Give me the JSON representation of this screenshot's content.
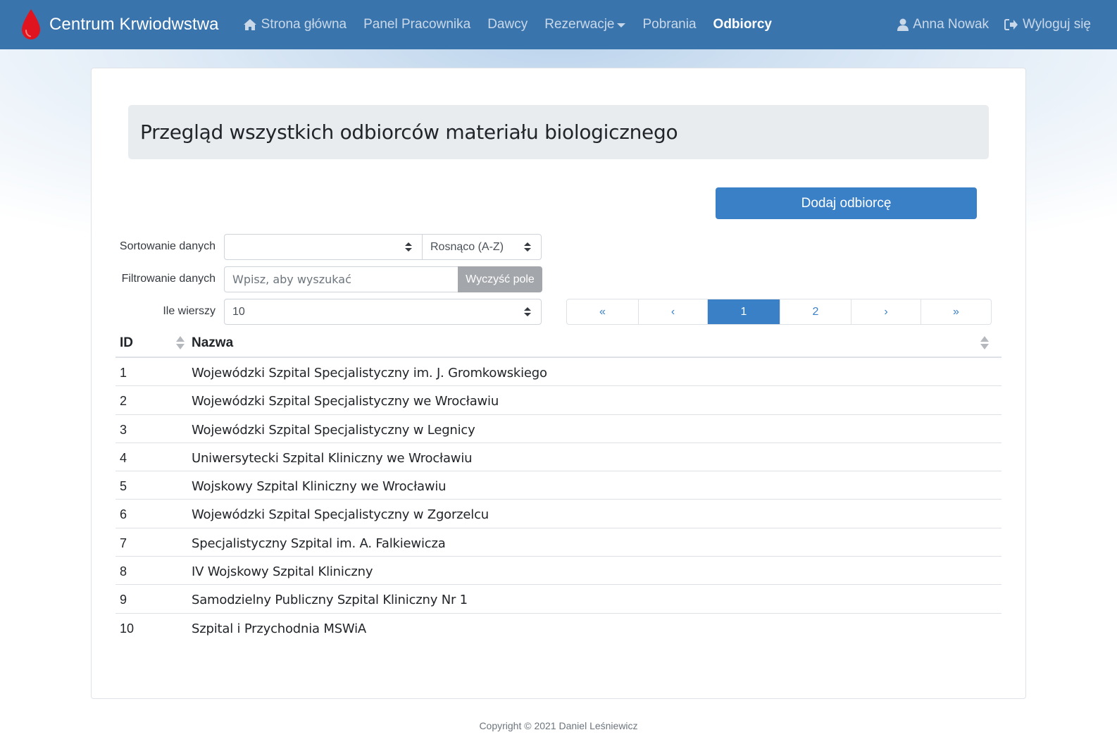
{
  "brand": {
    "title": "Centrum Krwiodwstwa",
    "logo_color": "#e0141e"
  },
  "nav": {
    "home": "Strona główna",
    "panel": "Panel Pracownika",
    "donors": "Dawcy",
    "reservations": "Rezerwacje",
    "collections": "Pobrania",
    "recipients": "Odbiorcy",
    "user": "Anna Nowak",
    "logout": "Wyloguj się"
  },
  "page": {
    "title": "Przegląd wszystkich odbiorców materiału biologicznego",
    "add_button": "Dodaj odbiorcę"
  },
  "controls": {
    "sort_label": "Sortowanie danych",
    "sort_field_value": "",
    "sort_order_value": "Rosnąco (A-Z)",
    "filter_label": "Filtrowanie danych",
    "filter_placeholder": "Wpisz, aby wyszukać",
    "clear_button": "Wyczyść pole",
    "rows_label": "Ile wierszy",
    "rows_value": "10"
  },
  "pagination": {
    "first": "«",
    "prev": "‹",
    "pages": [
      "1",
      "2"
    ],
    "current": "1",
    "next": "›",
    "last": "»"
  },
  "table": {
    "headers": {
      "id": "ID",
      "name": "Nazwa"
    },
    "rows": [
      {
        "id": "1",
        "name": "Wojewódzki Szpital Specjalistyczny im. J. Gromkowskiego"
      },
      {
        "id": "2",
        "name": "Wojewódzki Szpital Specjalistyczny we Wrocławiu"
      },
      {
        "id": "3",
        "name": "Wojewódzki Szpital Specjalistyczny w Legnicy"
      },
      {
        "id": "4",
        "name": "Uniwersytecki Szpital Kliniczny we Wrocławiu"
      },
      {
        "id": "5",
        "name": "Wojskowy Szpital Kliniczny we Wrocławiu"
      },
      {
        "id": "6",
        "name": "Wojewódzki Szpital Specjalistyczny w Zgorzelcu"
      },
      {
        "id": "7",
        "name": "Specjalistyczny Szpital im. A. Falkiewicza"
      },
      {
        "id": "8",
        "name": "IV Wojskowy Szpital Kliniczny"
      },
      {
        "id": "9",
        "name": "Samodzielny Publiczny Szpital Kliniczny Nr 1"
      },
      {
        "id": "10",
        "name": "Szpital i Przychodnia MSWiA"
      }
    ]
  },
  "footer": {
    "copyright": "Copyright © 2021 Daniel Leśniewicz"
  },
  "colors": {
    "navbar": "#3a74ad",
    "primary": "#3a80c7",
    "secondary": "#a3a7ab"
  }
}
